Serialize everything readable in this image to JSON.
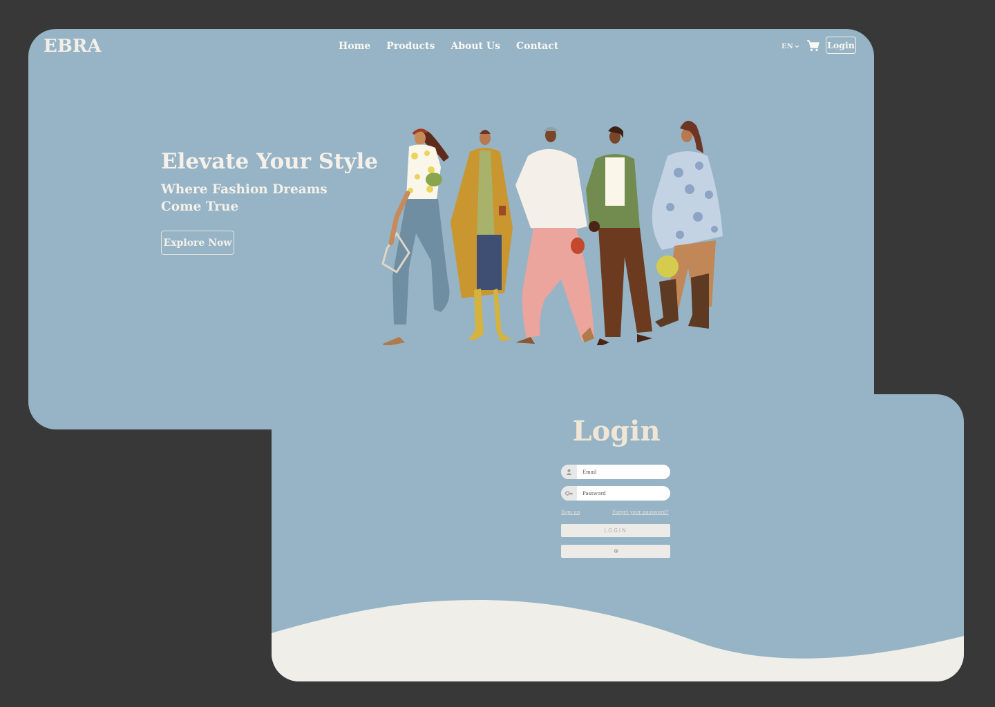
{
  "brand": {
    "logo": "EBRA"
  },
  "nav": {
    "items": [
      "Home",
      "Products",
      "About Us",
      "Contact"
    ]
  },
  "header": {
    "language": "EN",
    "login_label": "Login"
  },
  "hero": {
    "title": "Elevate Your Style",
    "subtitle": "Where Fashion Dreams Come True",
    "cta_label": "Explore Now"
  },
  "login_form": {
    "title": "Login",
    "email_placeholder": "Email",
    "password_placeholder": "Password",
    "signup_label": "Sign up",
    "forgot_label": "Forget your password?",
    "submit_label": "LOGIN"
  },
  "icons": {
    "cart": "cart-icon",
    "user": "user-icon",
    "password": "key-icon",
    "google": "google-icon",
    "language_caret": "chevron-down-icon"
  },
  "colors": {
    "background": "#383838",
    "panel": "#96b4c5",
    "cream": "#f0eee8",
    "title_login": "#f1e6d6"
  }
}
